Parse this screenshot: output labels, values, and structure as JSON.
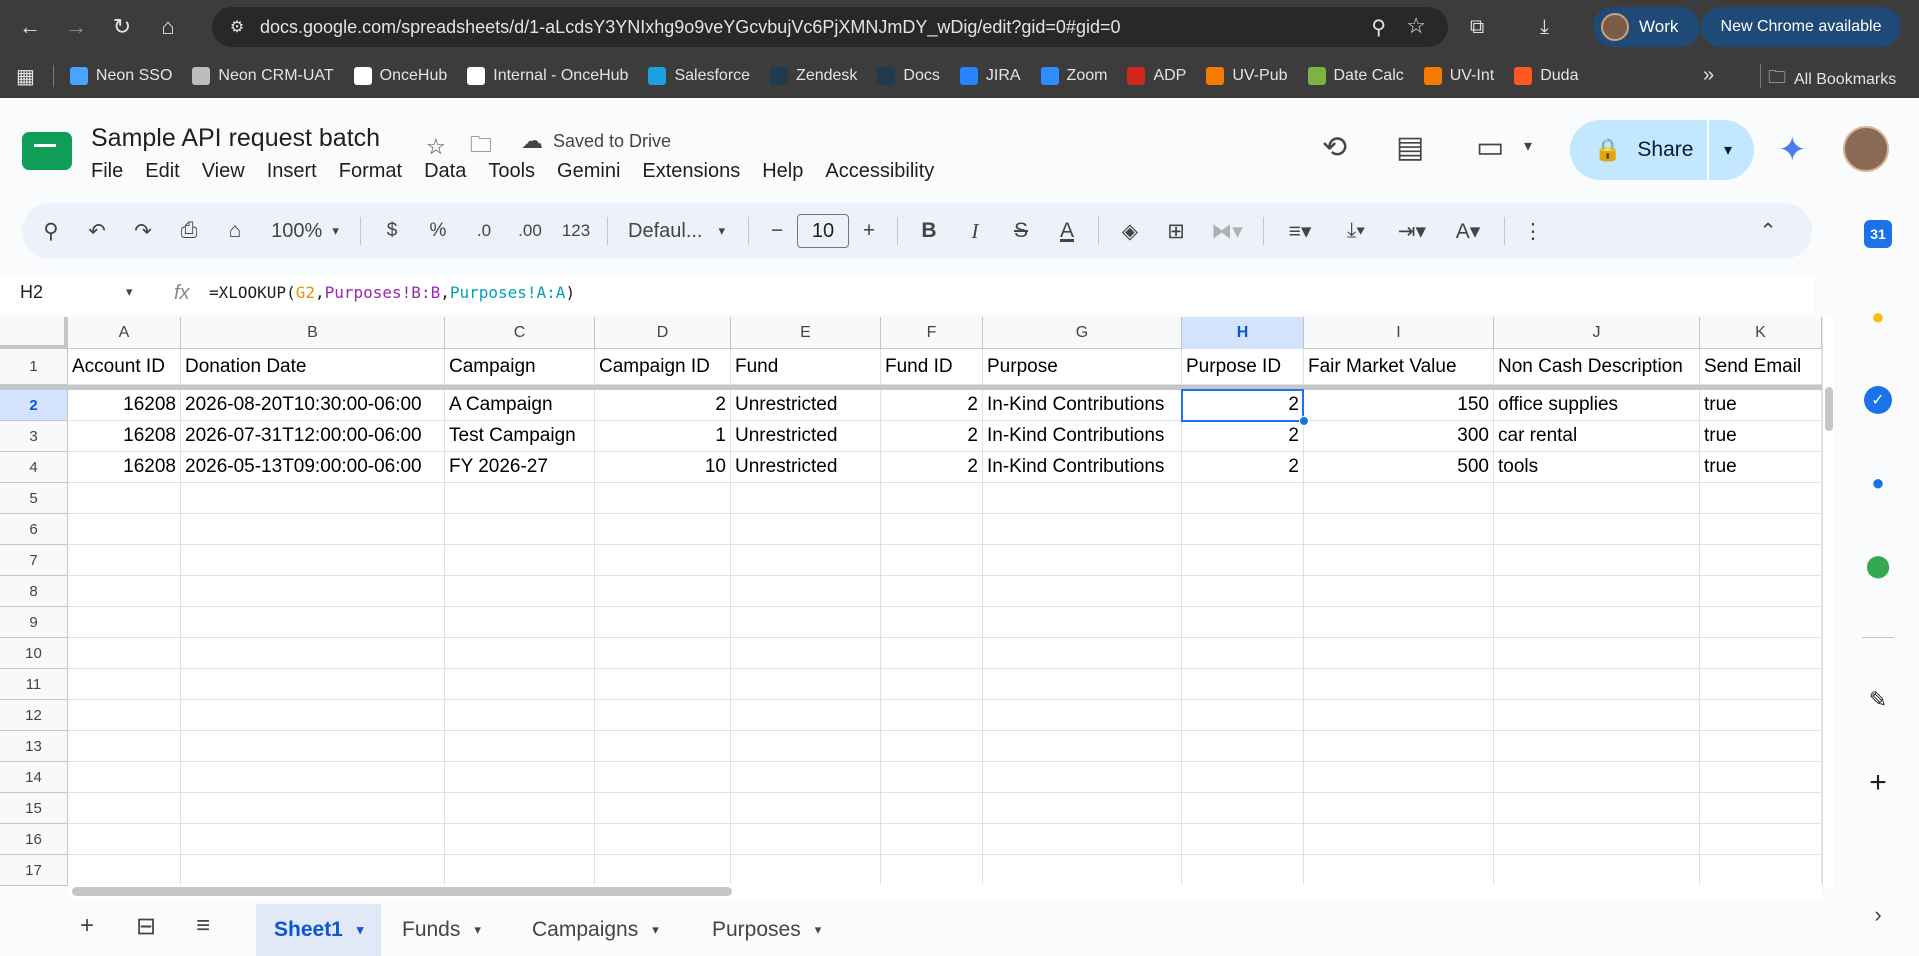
{
  "browser": {
    "url": "docs.google.com/spreadsheets/d/1-aLcdsY3YNIxhg9o9veYGcvbujVc6PjXMNJmDY_wDig/edit?gid=0#gid=0",
    "profile_label": "Work",
    "update_label": "New Chrome available",
    "bookmarks": [
      {
        "label": "Neon SSO",
        "color": "#4aa3ff"
      },
      {
        "label": "Neon CRM-UAT",
        "color": "#bdbdbd"
      },
      {
        "label": "OnceHub",
        "color": "#ffffff"
      },
      {
        "label": "Internal - OnceHub",
        "color": "#ffffff"
      },
      {
        "label": "Salesforce",
        "color": "#1ba1e2"
      },
      {
        "label": "Zendesk",
        "color": "#1f3b4d"
      },
      {
        "label": "Docs",
        "color": "#1f3b4d"
      },
      {
        "label": "JIRA",
        "color": "#2684ff"
      },
      {
        "label": "Zoom",
        "color": "#2d8cff"
      },
      {
        "label": "ADP",
        "color": "#d0271d"
      },
      {
        "label": "UV-Pub",
        "color": "#f57c00"
      },
      {
        "label": "Date Calc",
        "color": "#7cb342"
      },
      {
        "label": "UV-Int",
        "color": "#f57c00"
      },
      {
        "label": "Duda",
        "color": "#ff5722"
      }
    ],
    "all_bookmarks_label": "All Bookmarks"
  },
  "doc": {
    "title": "Sample API request batch",
    "save_status": "Saved to Drive",
    "menu": [
      "File",
      "Edit",
      "View",
      "Insert",
      "Format",
      "Data",
      "Tools",
      "Gemini",
      "Extensions",
      "Help",
      "Accessibility"
    ],
    "share_label": "Share"
  },
  "toolbar": {
    "zoom": "100%",
    "currency": "$",
    "percent": "%",
    "dec_decrease": ".0",
    "dec_increase": ".00",
    "number_format": "123",
    "font": "Defaul...",
    "font_size": "10"
  },
  "formula_bar": {
    "name_box": "H2",
    "fx": "fx",
    "formula_parts": [
      "=XLOOKUP(",
      "G2",
      ",",
      "Purposes!B:B",
      ",",
      "Purposes!A:A",
      ")"
    ]
  },
  "grid": {
    "columns": [
      "A",
      "B",
      "C",
      "D",
      "E",
      "F",
      "G",
      "H",
      "I",
      "J",
      "K"
    ],
    "selected_column": "H",
    "selected_row": "2",
    "row_numbers": [
      "1",
      "2",
      "3",
      "4",
      "5",
      "6",
      "7",
      "8",
      "9",
      "10",
      "11",
      "12",
      "13",
      "14",
      "15",
      "16",
      "17"
    ],
    "header_row": [
      "Account ID",
      "Donation Date",
      "Campaign",
      "Campaign ID",
      "Fund",
      "Fund ID",
      "Purpose",
      "Purpose ID",
      "Fair Market Value",
      "Non Cash Description",
      "Send Email"
    ],
    "data_rows": [
      [
        "16208",
        "2026-08-20T10:30:00-06:00",
        "A Campaign",
        "2",
        "Unrestricted",
        "2",
        "In-Kind Contributions",
        "2",
        "150",
        "office supplies",
        "true"
      ],
      [
        "16208",
        "2026-07-31T12:00:00-06:00",
        "Test Campaign",
        "1",
        "Unrestricted",
        "2",
        "In-Kind Contributions",
        "2",
        "300",
        "car rental",
        "true"
      ],
      [
        "16208",
        "2026-05-13T09:00:00-06:00",
        "FY 2026-27",
        "10",
        "Unrestricted",
        "2",
        "In-Kind Contributions",
        "2",
        "500",
        "tools",
        "true"
      ]
    ]
  },
  "sheets": [
    {
      "label": "Sheet1",
      "active": true
    },
    {
      "label": "Funds",
      "active": false
    },
    {
      "label": "Campaigns",
      "active": false
    },
    {
      "label": "Purposes",
      "active": false
    }
  ],
  "side_panel": {
    "calendar_day": "31"
  },
  "colors": {
    "accent": "#0b57d0",
    "share_bg": "#c2e7ff",
    "sheets_green": "#0f9d58",
    "selection": "#1a73e8"
  }
}
